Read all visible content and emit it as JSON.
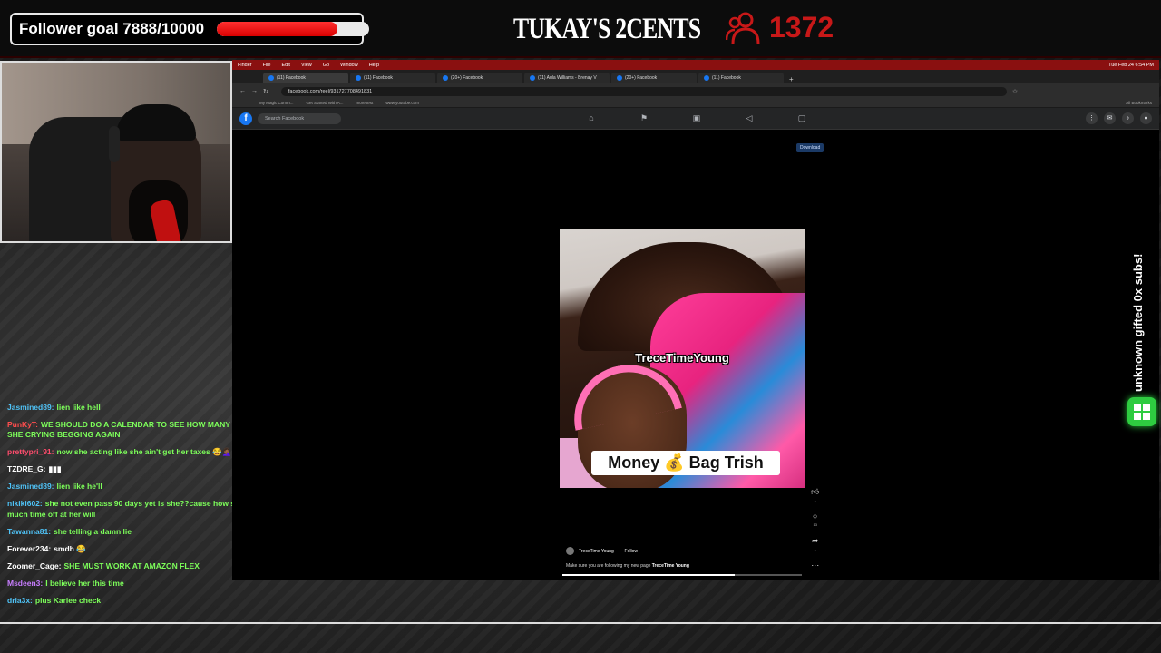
{
  "overlay": {
    "follower_goal_label": "Follower goal 7888/10000",
    "follower_goal_progress": 0.7888,
    "brand_text": "TUKAY'S 2CENTS",
    "viewer_count": "1372",
    "sub_alert": "unknown gifted 0x subs!",
    "accent_color": "#c81818",
    "alert_badge_color": "#2ecc40"
  },
  "chat": [
    {
      "user": "Jasmined89:",
      "text": "lien like hell",
      "user_color": "#4fc3f7",
      "text_white": false
    },
    {
      "user": "PunKyT:",
      "text": "WE SHOULD DO A CALENDAR TO SEE HOW MANY DAYS UNTIL SHE CRYING BEGGING AGAIN",
      "user_color": "#ff4d4d",
      "text_white": false
    },
    {
      "user": "prettypri_91:",
      "text": "now she acting like she ain't get her taxes 😂🤦🏾‍♀️",
      "user_color": "#ff4d6d",
      "text_white": false
    },
    {
      "user": "TZDRE_G:",
      "text": "▮▮▮",
      "user_color": "#ffffff",
      "text_white": true
    },
    {
      "user": "Jasmined89:",
      "text": "lien like he'll",
      "user_color": "#4fc3f7",
      "text_white": false
    },
    {
      "user": "nikiki602:",
      "text": "she not even pass 90 days yet is she??cause how she gt so much time off at her will",
      "user_color": "#4fc3f7",
      "text_white": false
    },
    {
      "user": "Tawanna81:",
      "text": "she telling a damn lie",
      "user_color": "#4fc3f7",
      "text_white": false
    },
    {
      "user": "Forever234:",
      "text": "smdh 😂",
      "user_color": "#ffffff",
      "text_white": true
    },
    {
      "user": "Zoomer_Cage:",
      "text": "SHE MUST WORK AT AMAZON FLEX",
      "user_color": "#ffffff",
      "text_white": false
    },
    {
      "user": "Msdeen3:",
      "text": "I believe her this time",
      "user_color": "#c77dff",
      "text_white": false
    },
    {
      "user": "dria3x:",
      "text": "plus Kariee check",
      "user_color": "#4fc3f7",
      "text_white": false
    }
  ],
  "mac_menu": {
    "items": [
      "Finder",
      "File",
      "Edit",
      "View",
      "Go",
      "Window",
      "Help"
    ],
    "clock": "Tue Feb 24 6:54 PM"
  },
  "tabs": [
    {
      "label": "(11) Facebook",
      "active": true
    },
    {
      "label": "(11) Facebook",
      "active": false
    },
    {
      "label": "(20+) Facebook",
      "active": false
    },
    {
      "label": "(11) Aula Williams - Brenay V",
      "active": false
    },
    {
      "label": "(20+) Facebook",
      "active": false
    },
    {
      "label": "(11) Facebook",
      "active": false
    }
  ],
  "address": {
    "url": "facebook.com/reel/931727708491831"
  },
  "bookmarks": {
    "items": [
      "My Magic Comm...",
      "Get Started With A...",
      "more test",
      "www.youtube.com"
    ],
    "all_bookmarks": "All Bookmarks"
  },
  "facebook": {
    "search_placeholder": "Search Facebook",
    "download_label": "Download"
  },
  "reel": {
    "overlay_username": "TreceTimeYoung",
    "caption": "Money 💰 Bag Trish",
    "author": "TreceTime Young",
    "follow_label": "Follow",
    "description_prefix": "Make sure you are following my new page ",
    "description_link": "TreceTime Young",
    "like_count": "1",
    "comment_count": "13",
    "share_count": "1",
    "progress": 0.72
  }
}
